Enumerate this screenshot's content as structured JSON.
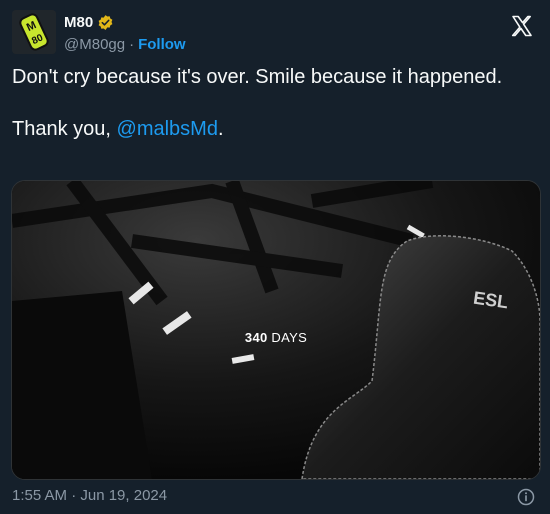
{
  "account": {
    "display_name": "M80",
    "handle": "@M80gg",
    "separator": "·",
    "follow_label": "Follow",
    "avatar_text": "M80"
  },
  "tweet": {
    "line1": "Don't cry because it's over. Smile because it happened.",
    "line2_prefix": "Thank you, ",
    "mention": "@malbsMd",
    "line2_suffix": "."
  },
  "media": {
    "days_number": "340",
    "days_word": " DAYS",
    "chair_brand": "ESL"
  },
  "footer": {
    "timestamp": "1:55 AM · Jun 19, 2024"
  },
  "icons": {
    "verified": "verified-badge-icon",
    "x_logo": "x-logo-icon",
    "info": "info-icon"
  },
  "colors": {
    "background": "#15202b",
    "accent": "#1d9bf0",
    "verified_gold": "#e2b719",
    "brand_green": "#c8e62e"
  }
}
